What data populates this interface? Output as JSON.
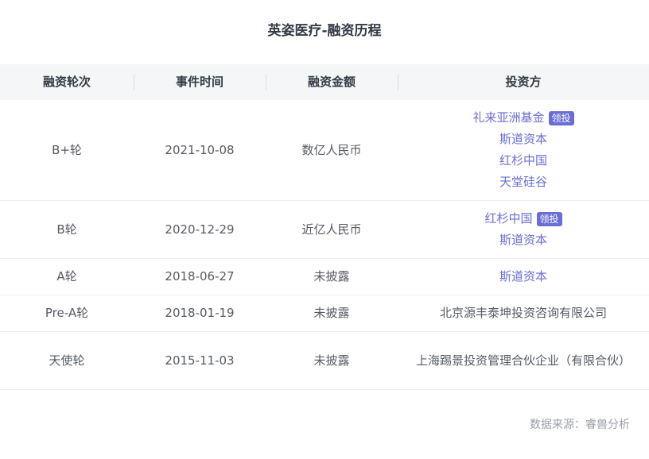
{
  "title": "英姿医疗-融资历程",
  "table": {
    "headers": [
      "融资轮次",
      "事件时间",
      "融资金额",
      "投资方"
    ],
    "rows": [
      {
        "round": "B+轮",
        "date": "2021-10-08",
        "amount": "数亿人民币",
        "investors": [
          {
            "name": "礼来亚洲基金",
            "lead": "领投"
          },
          {
            "name": "斯道资本"
          },
          {
            "name": "红杉中国"
          },
          {
            "name": "天堂硅谷"
          }
        ]
      },
      {
        "round": "B轮",
        "date": "2020-12-29",
        "amount": "近亿人民币",
        "investors": [
          {
            "name": "红杉中国",
            "lead": "领投"
          },
          {
            "name": "斯道资本"
          }
        ]
      },
      {
        "round": "A轮",
        "date": "2018-06-27",
        "amount": "未披露",
        "investors": [
          {
            "name": "斯道资本"
          }
        ]
      },
      {
        "round": "Pre-A轮",
        "date": "2018-01-19",
        "amount": "未披露",
        "investors_text": "北京源丰泰坤投资咨询有限公司"
      },
      {
        "round": "天使轮",
        "date": "2015-11-03",
        "amount": "未披露",
        "investors_text": "上海踢景投资管理合伙企业（有限合伙）"
      }
    ]
  },
  "source": "数据来源：睿兽分析",
  "colors": {
    "link": "#6a6ed4",
    "text": "#555a63",
    "header_bg": "#f5f6f7"
  }
}
